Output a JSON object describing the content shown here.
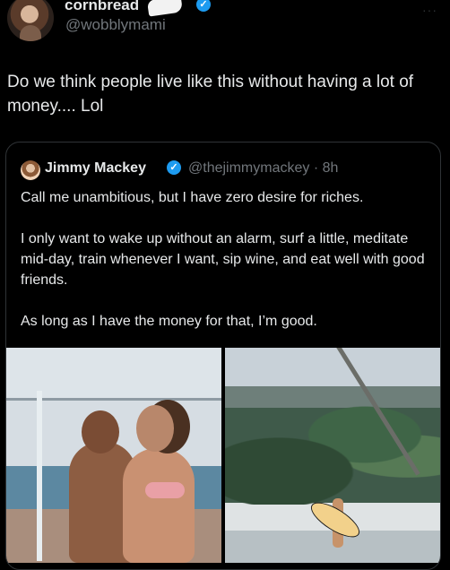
{
  "header": {
    "display_name": "cornbread",
    "username": "@wobblymami",
    "more": "···"
  },
  "tweet": {
    "text": "Do we think people live like this without having a lot of money.... Lol"
  },
  "quote": {
    "name": "Jimmy Mackey",
    "meta": "@thejimmymackey · 8h",
    "paragraphs": [
      "Call me unambitious, but I have zero desire for riches.",
      "I only want to wake up without an alarm, surf a little, meditate mid-day, train whenever I want, sip wine, and eat well with good friends.",
      "As long as I have the money for that, I’m good."
    ]
  },
  "icons": {
    "verified": "verified-badge-icon",
    "more": "more-icon"
  },
  "colors": {
    "background": "#000000",
    "text": "#e7e9ea",
    "muted": "#71767b",
    "verified": "#1d9bf0",
    "border": "#2f3336"
  }
}
